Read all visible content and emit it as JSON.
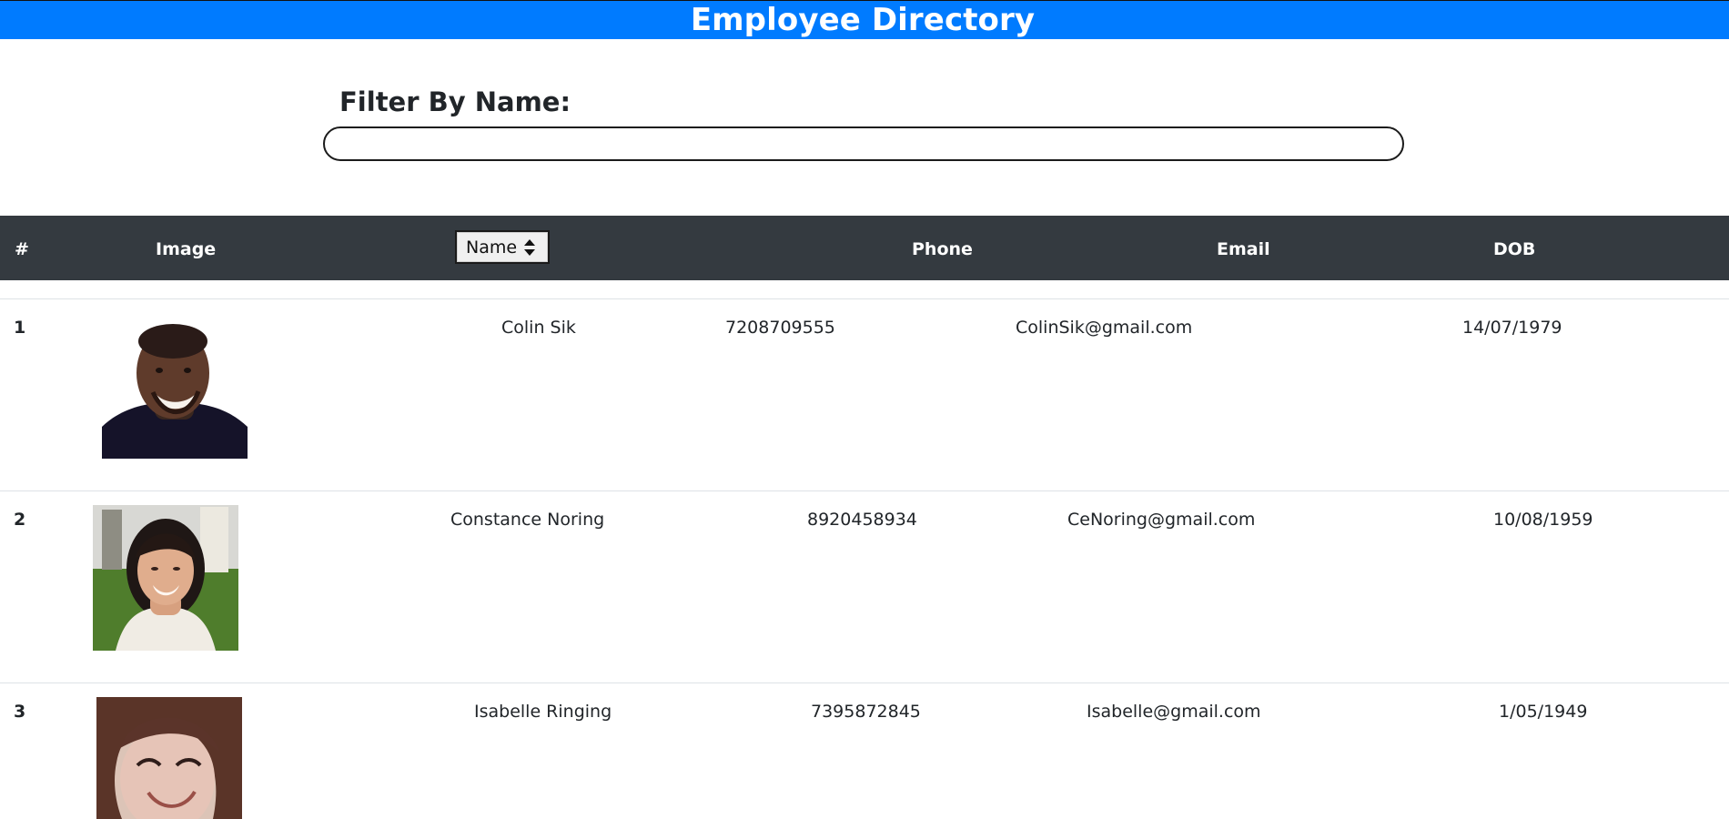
{
  "header": {
    "title": "Employee Directory"
  },
  "filter": {
    "label": "Filter By Name:",
    "value": "",
    "placeholder": ""
  },
  "table": {
    "headers": {
      "index": "#",
      "image": "Image",
      "name_sort": "Name",
      "phone": "Phone",
      "email": "Email",
      "dob": "DOB"
    },
    "rows": [
      {
        "index": "1",
        "image": "avatar-man-smiling",
        "name": "Colin Sik",
        "phone": "7208709555",
        "email": "ColinSik@gmail.com",
        "dob": "14/07/1979"
      },
      {
        "index": "2",
        "image": "avatar-woman-smiling",
        "name": "Constance Noring",
        "phone": "8920458934",
        "email": "CeNoring@gmail.com",
        "dob": "10/08/1959"
      },
      {
        "index": "3",
        "image": "avatar-woman-closeup",
        "name": "Isabelle Ringing",
        "phone": "7395872845",
        "email": "Isabelle@gmail.com",
        "dob": "1/05/1949"
      }
    ]
  },
  "colors": {
    "header_bg": "#007bff",
    "table_header_bg": "#343a40",
    "divider": "#dee2e6",
    "text": "#212529"
  }
}
